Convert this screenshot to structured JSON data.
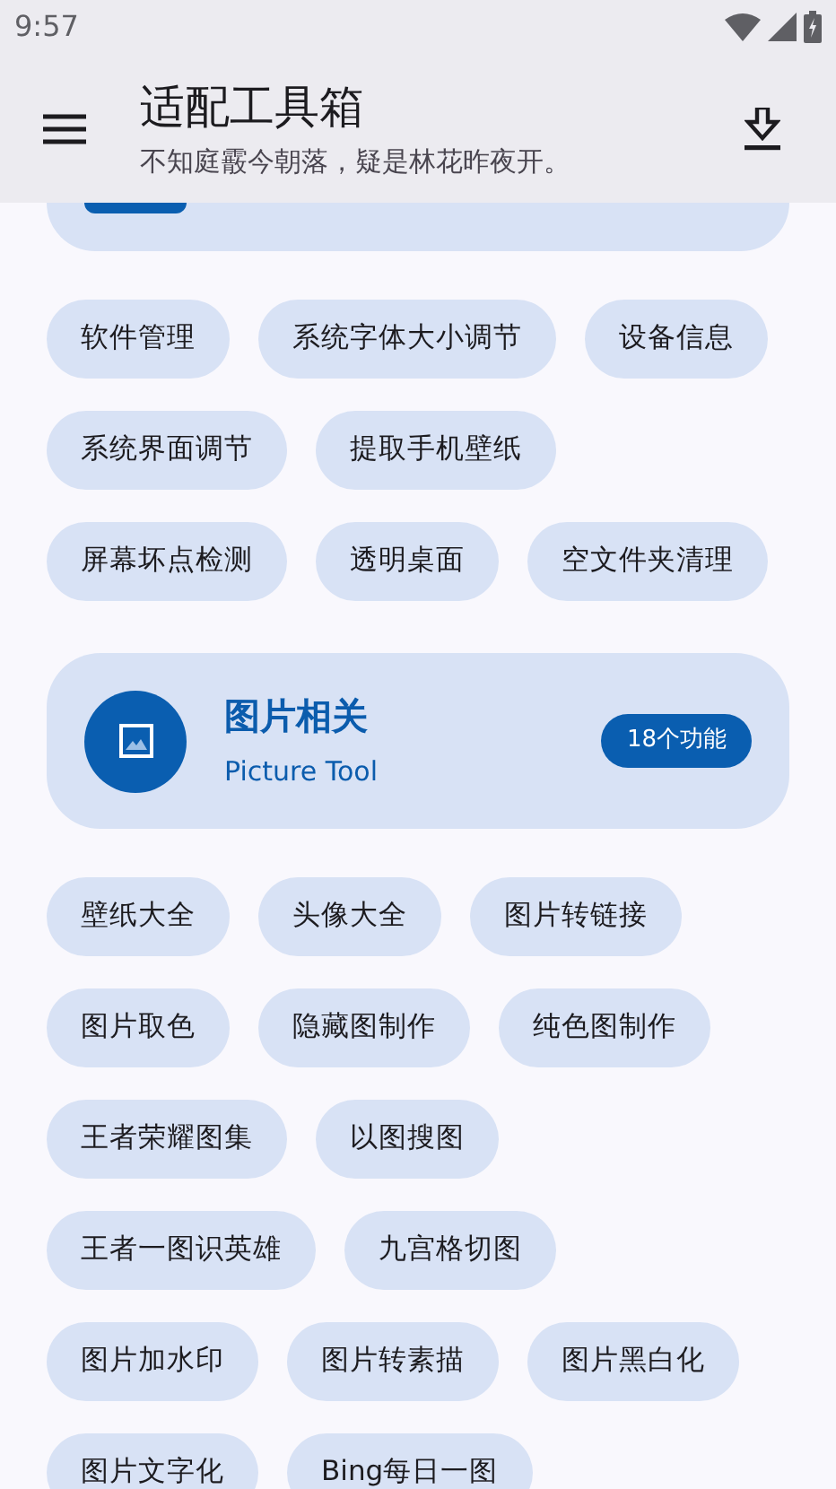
{
  "status_bar": {
    "time": "9:57"
  },
  "app_bar": {
    "title": "适配工具箱",
    "subtitle": "不知庭霰今朝落，疑是林花昨夜开。"
  },
  "sections": [
    {
      "chip_rows": [
        [
          "软件管理",
          "系统字体大小调节",
          "设备信息"
        ],
        [
          "系统界面调节",
          "提取手机壁纸"
        ],
        [
          "屏幕坏点检测",
          "透明桌面",
          "空文件夹清理"
        ]
      ]
    },
    {
      "card": {
        "title": "图片相关",
        "subtitle": "Picture Tool",
        "badge": "18个功能"
      },
      "chip_rows": [
        [
          "壁纸大全",
          "头像大全",
          "图片转链接"
        ],
        [
          "图片取色",
          "隐藏图制作",
          "纯色图制作"
        ],
        [
          "王者荣耀图集",
          "以图搜图"
        ],
        [
          "王者一图识英雄",
          "九宫格切图"
        ],
        [
          "图片加水印",
          "图片转素描",
          "图片黑白化"
        ],
        [
          "图片文字化",
          "Bing每日一图"
        ]
      ]
    }
  ]
}
